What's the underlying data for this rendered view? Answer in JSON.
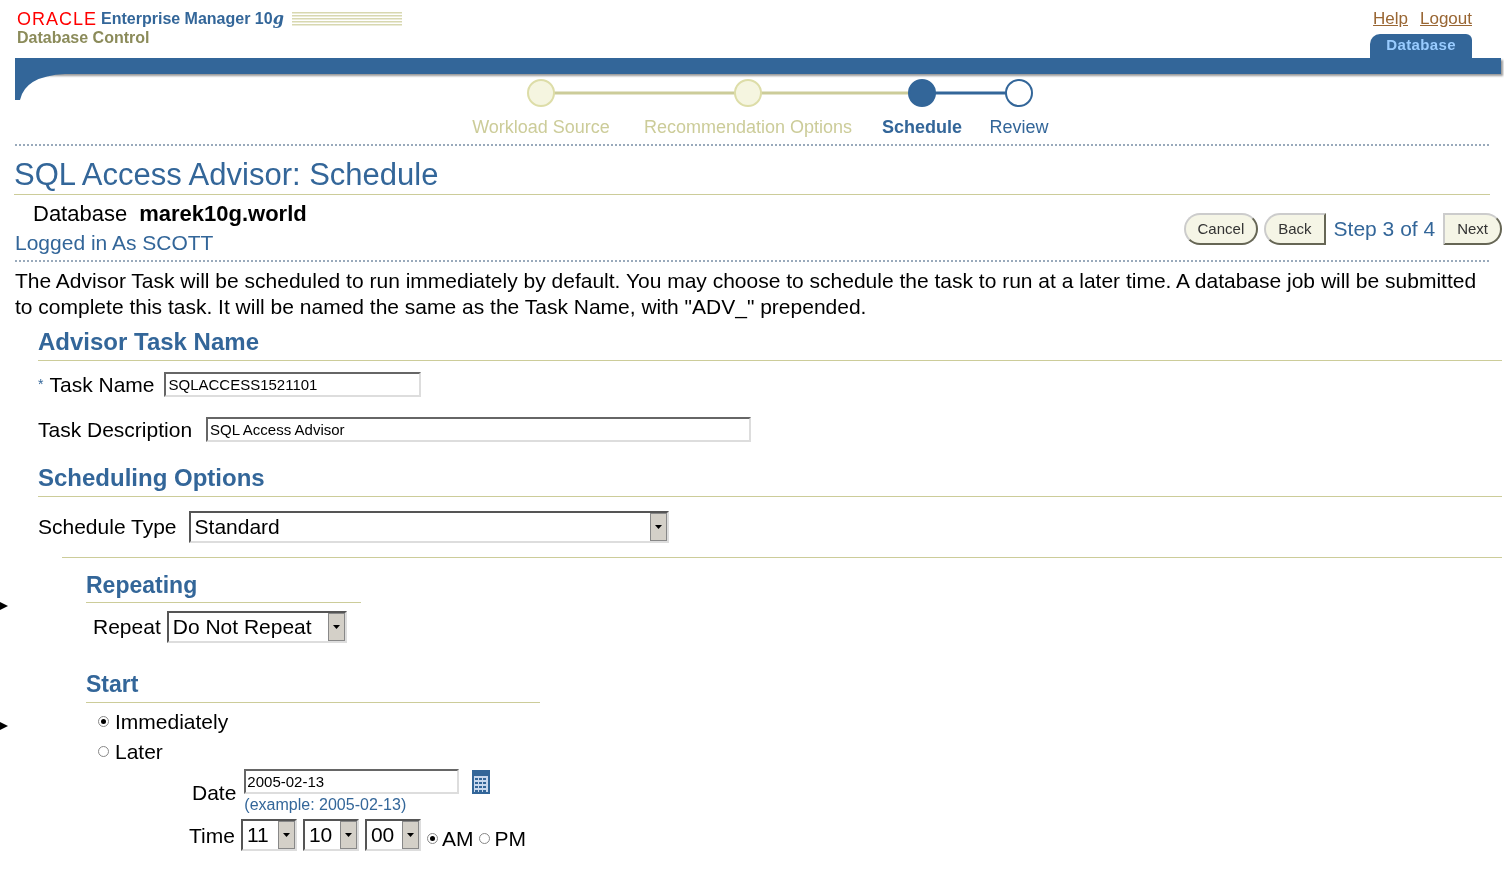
{
  "brand": {
    "logo": "ORACLE",
    "product": "Enterprise Manager 10",
    "product_suffix": "g",
    "subtitle": "Database Control"
  },
  "global_links": [
    {
      "label": "Help"
    },
    {
      "label": "Logout"
    }
  ],
  "tabs": [
    {
      "label": "Database",
      "selected": true
    }
  ],
  "train": [
    {
      "label": "Workload Source",
      "selected": false,
      "visited": true
    },
    {
      "label": "Recommendation Options",
      "selected": false,
      "visited": true
    },
    {
      "label": "Schedule",
      "selected": true,
      "visited": true
    },
    {
      "label": "Review",
      "selected": false,
      "visited": false
    }
  ],
  "title": "SQL Access Advisor: Schedule",
  "database": {
    "label": "Database",
    "value": "marek10g.world"
  },
  "logged_in": "Logged in As SCOTT",
  "buttons": {
    "cancel": "Cancel",
    "back": "Back",
    "step": "Step 3 of 4",
    "next": "Next"
  },
  "intro": "The Advisor Task will be scheduled to run immediately by default. You may choose to schedule the task to run at a later time. A database job will be submitted to complete this task. It will be named the same as the Task Name, with \"ADV_\" prepended.",
  "task_section": {
    "heading": "Advisor Task Name",
    "required_mark": "*",
    "task_name": {
      "label": "Task Name",
      "value": "SQLACCESS1521101"
    },
    "task_description": {
      "label": "Task Description",
      "value": "SQL Access Advisor"
    }
  },
  "scheduling": {
    "heading": "Scheduling Options",
    "schedule_type": {
      "label": "Schedule Type",
      "value": "Standard"
    }
  },
  "repeating": {
    "heading": "Repeating",
    "repeat": {
      "label": "Repeat",
      "value": "Do Not Repeat"
    }
  },
  "start": {
    "heading": "Start",
    "options": [
      {
        "label": "Immediately",
        "selected": true
      },
      {
        "label": "Later",
        "selected": false
      }
    ],
    "date": {
      "label": "Date",
      "value": "2005-02-13",
      "hint": "(example: 2005-02-13)"
    },
    "time": {
      "label": "Time",
      "hour": "11",
      "minute": "10",
      "second": "00",
      "meridiem": [
        {
          "label": "AM",
          "selected": true
        },
        {
          "label": "PM",
          "selected": false
        }
      ]
    }
  }
}
